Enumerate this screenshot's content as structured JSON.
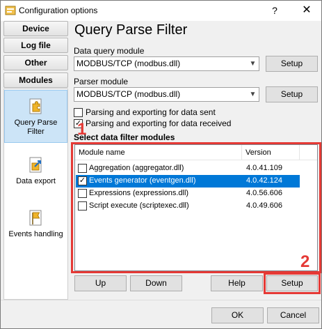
{
  "window": {
    "title": "Configuration options",
    "help_glyph": "?",
    "close_glyph": "✕"
  },
  "nav": {
    "buttons": [
      "Device",
      "Log file",
      "Other",
      "Modules"
    ],
    "items": [
      {
        "label": "Query Parse Filter",
        "icon": "puzzle-piece-icon",
        "selected": true
      },
      {
        "label": "Data export",
        "icon": "export-arrow-icon",
        "selected": false
      },
      {
        "label": "Events handling",
        "icon": "flag-icon",
        "selected": false
      }
    ]
  },
  "page": {
    "title": "Query Parse Filter"
  },
  "data_query": {
    "label": "Data query module",
    "value": "MODBUS/TCP (modbus.dll)",
    "setup_label": "Setup"
  },
  "parser": {
    "label": "Parser module",
    "value": "MODBUS/TCP (modbus.dll)",
    "setup_label": "Setup"
  },
  "options": [
    {
      "label": "Parsing and exporting for data sent",
      "checked": false
    },
    {
      "label": "Parsing and exporting for data received",
      "checked": true
    }
  ],
  "filters": {
    "section_label": "Select data filter modules",
    "columns": [
      "Module name",
      "Version"
    ],
    "rows": [
      {
        "name": "Aggregation (aggregator.dll)",
        "version": "4.0.41.109",
        "checked": false,
        "selected": false
      },
      {
        "name": "Events generator (eventgen.dll)",
        "version": "4.0.42.124",
        "checked": true,
        "selected": true
      },
      {
        "name": "Expressions (expressions.dll)",
        "version": "4.0.56.606",
        "checked": false,
        "selected": false
      },
      {
        "name": "Script execute (scriptexec.dll)",
        "version": "4.0.49.606",
        "checked": false,
        "selected": false
      }
    ],
    "buttons": {
      "up": "Up",
      "down": "Down",
      "help": "Help",
      "setup": "Setup"
    }
  },
  "annotations": {
    "marker1": "1",
    "marker2": "2",
    "color": "#e53935"
  },
  "footer": {
    "ok": "OK",
    "cancel": "Cancel"
  },
  "colors": {
    "selection": "#0078d7",
    "nav_selected": "#cce4f7"
  }
}
